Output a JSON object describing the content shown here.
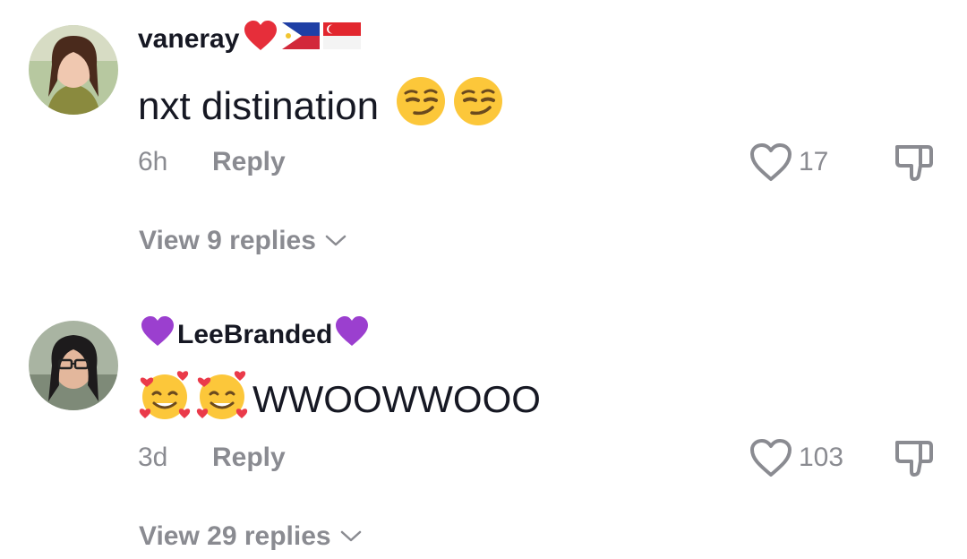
{
  "comments": [
    {
      "username": "vaneray",
      "username_emojis": [
        "red-heart",
        "philippines-flag",
        "singapore-flag"
      ],
      "text": "nxt distination",
      "text_emojis": [
        "smirking-face",
        "smirking-face"
      ],
      "time": "6h",
      "reply_label": "Reply",
      "likes": "17",
      "view_replies": "View 9 replies"
    },
    {
      "username": "LeeBranded",
      "username_emojis": [
        "purple-heart",
        "purple-heart"
      ],
      "text": "WWOOWWOOO",
      "text_emojis": [
        "smiling-face-with-hearts",
        "smiling-face-with-hearts"
      ],
      "time": "3d",
      "reply_label": "Reply",
      "likes": "103",
      "view_replies": "View 29 replies"
    }
  ],
  "colors": {
    "text_primary": "#161823",
    "text_secondary": "#8a8b91",
    "background": "#ffffff"
  }
}
